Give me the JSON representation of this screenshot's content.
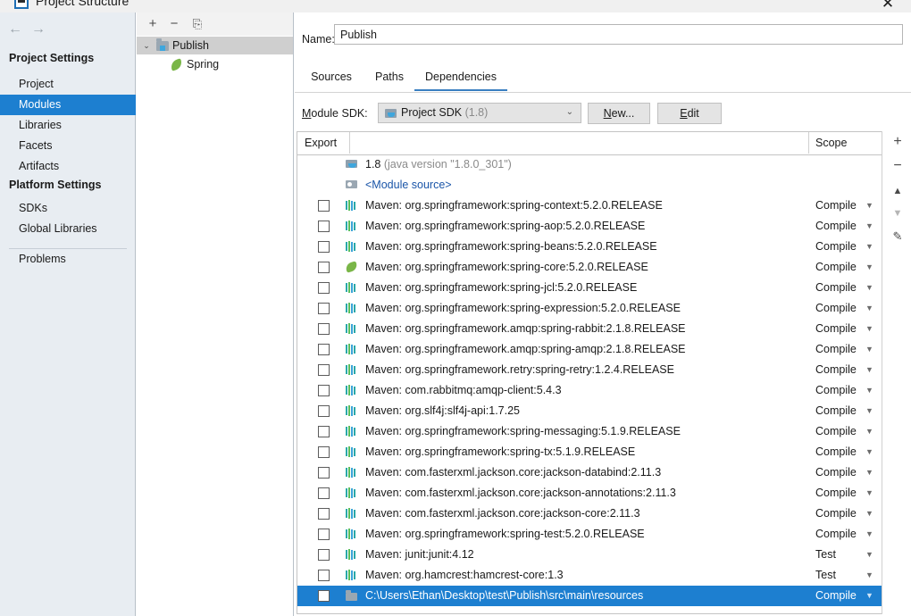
{
  "window": {
    "title": "Project Structure",
    "close_label": "✕",
    "app_icon": "project-structure-icon"
  },
  "sidebar": {
    "nav": {
      "back": "←",
      "forward": "→"
    },
    "groups": [
      {
        "label": "Project Settings",
        "items": [
          {
            "label": "Project",
            "selected": false
          },
          {
            "label": "Modules",
            "selected": true
          },
          {
            "label": "Libraries",
            "selected": false
          },
          {
            "label": "Facets",
            "selected": false
          },
          {
            "label": "Artifacts",
            "selected": false
          }
        ]
      },
      {
        "label": "Platform Settings",
        "items": [
          {
            "label": "SDKs",
            "selected": false
          },
          {
            "label": "Global Libraries",
            "selected": false
          }
        ]
      }
    ],
    "problems": {
      "label": "Problems"
    }
  },
  "tree": {
    "toolbar": {
      "add": "+",
      "remove": "−",
      "copy": "⎘"
    },
    "nodes": [
      {
        "label": "Publish",
        "icon": "module-folder-icon",
        "selected": true,
        "chevron": "⌄",
        "depth": 0
      },
      {
        "label": "Spring",
        "icon": "spring-leaf-icon",
        "selected": false,
        "chevron": "",
        "depth": 1
      }
    ]
  },
  "main": {
    "name_field": {
      "label": "Name:",
      "value": "Publish",
      "placeholder": ""
    },
    "tabs": [
      {
        "label": "Sources",
        "active": false
      },
      {
        "label": "Paths",
        "active": false
      },
      {
        "label": "Dependencies",
        "active": true
      }
    ],
    "module_sdk": {
      "label": "Module SDK:",
      "value": "Project SDK",
      "version": "(1.8)",
      "arrow": "⌄",
      "new_button": "New...",
      "edit_button": "Edit"
    },
    "table": {
      "headers": {
        "export": "Export",
        "scope": "Scope"
      },
      "add_button": "+",
      "rows": [
        {
          "icon": "jdk-icon",
          "checkbox": false,
          "label": "1.8",
          "label_muted": " (java version \"1.8.0_301\")",
          "scope": "",
          "selected": false,
          "link": false
        },
        {
          "icon": "module-source-icon",
          "checkbox": false,
          "label": "<Module source>",
          "label_muted": "",
          "scope": "",
          "selected": false,
          "link": true
        },
        {
          "icon": "maven-icon",
          "checkbox": true,
          "label": "Maven: org.springframework:spring-context:5.2.0.RELEASE",
          "label_muted": "",
          "scope": "Compile",
          "selected": false,
          "link": false
        },
        {
          "icon": "maven-icon",
          "checkbox": true,
          "label": "Maven: org.springframework:spring-aop:5.2.0.RELEASE",
          "label_muted": "",
          "scope": "Compile",
          "selected": false,
          "link": false
        },
        {
          "icon": "maven-icon",
          "checkbox": true,
          "label": "Maven: org.springframework:spring-beans:5.2.0.RELEASE",
          "label_muted": "",
          "scope": "Compile",
          "selected": false,
          "link": false
        },
        {
          "icon": "spring-leaf-icon",
          "checkbox": true,
          "label": "Maven: org.springframework:spring-core:5.2.0.RELEASE",
          "label_muted": "",
          "scope": "Compile",
          "selected": false,
          "link": false
        },
        {
          "icon": "maven-icon",
          "checkbox": true,
          "label": "Maven: org.springframework:spring-jcl:5.2.0.RELEASE",
          "label_muted": "",
          "scope": "Compile",
          "selected": false,
          "link": false
        },
        {
          "icon": "maven-icon",
          "checkbox": true,
          "label": "Maven: org.springframework:spring-expression:5.2.0.RELEASE",
          "label_muted": "",
          "scope": "Compile",
          "selected": false,
          "link": false
        },
        {
          "icon": "maven-icon",
          "checkbox": true,
          "label": "Maven: org.springframework.amqp:spring-rabbit:2.1.8.RELEASE",
          "label_muted": "",
          "scope": "Compile",
          "selected": false,
          "link": false
        },
        {
          "icon": "maven-icon",
          "checkbox": true,
          "label": "Maven: org.springframework.amqp:spring-amqp:2.1.8.RELEASE",
          "label_muted": "",
          "scope": "Compile",
          "selected": false,
          "link": false
        },
        {
          "icon": "maven-icon",
          "checkbox": true,
          "label": "Maven: org.springframework.retry:spring-retry:1.2.4.RELEASE",
          "label_muted": "",
          "scope": "Compile",
          "selected": false,
          "link": false
        },
        {
          "icon": "maven-icon",
          "checkbox": true,
          "label": "Maven: com.rabbitmq:amqp-client:5.4.3",
          "label_muted": "",
          "scope": "Compile",
          "selected": false,
          "link": false
        },
        {
          "icon": "maven-icon",
          "checkbox": true,
          "label": "Maven: org.slf4j:slf4j-api:1.7.25",
          "label_muted": "",
          "scope": "Compile",
          "selected": false,
          "link": false
        },
        {
          "icon": "maven-icon",
          "checkbox": true,
          "label": "Maven: org.springframework:spring-messaging:5.1.9.RELEASE",
          "label_muted": "",
          "scope": "Compile",
          "selected": false,
          "link": false
        },
        {
          "icon": "maven-icon",
          "checkbox": true,
          "label": "Maven: org.springframework:spring-tx:5.1.9.RELEASE",
          "label_muted": "",
          "scope": "Compile",
          "selected": false,
          "link": false
        },
        {
          "icon": "maven-icon",
          "checkbox": true,
          "label": "Maven: com.fasterxml.jackson.core:jackson-databind:2.11.3",
          "label_muted": "",
          "scope": "Compile",
          "selected": false,
          "link": false
        },
        {
          "icon": "maven-icon",
          "checkbox": true,
          "label": "Maven: com.fasterxml.jackson.core:jackson-annotations:2.11.3",
          "label_muted": "",
          "scope": "Compile",
          "selected": false,
          "link": false
        },
        {
          "icon": "maven-icon",
          "checkbox": true,
          "label": "Maven: com.fasterxml.jackson.core:jackson-core:2.11.3",
          "label_muted": "",
          "scope": "Compile",
          "selected": false,
          "link": false
        },
        {
          "icon": "maven-icon",
          "checkbox": true,
          "label": "Maven: org.springframework:spring-test:5.2.0.RELEASE",
          "label_muted": "",
          "scope": "Compile",
          "selected": false,
          "link": false
        },
        {
          "icon": "maven-icon",
          "checkbox": true,
          "label": "Maven: junit:junit:4.12",
          "label_muted": "",
          "scope": "Test",
          "selected": false,
          "link": false
        },
        {
          "icon": "maven-icon",
          "checkbox": true,
          "label": "Maven: org.hamcrest:hamcrest-core:1.3",
          "label_muted": "",
          "scope": "Test",
          "selected": false,
          "link": false
        },
        {
          "icon": "folder-icon",
          "checkbox": true,
          "label": "C:\\Users\\Ethan\\Desktop\\test\\Publish\\src\\main\\resources",
          "label_muted": "",
          "scope": "Compile",
          "selected": true,
          "link": false
        }
      ]
    },
    "side_toolbar": {
      "add": "+",
      "remove": "−",
      "move_up": "▲",
      "move_down": "▼",
      "edit": "✎"
    }
  },
  "colors": {
    "accent": "#1d7fd0",
    "tab_underline": "#3a7fc1",
    "sidebar_bg": "#e8edf2",
    "link": "#1a55a8"
  }
}
